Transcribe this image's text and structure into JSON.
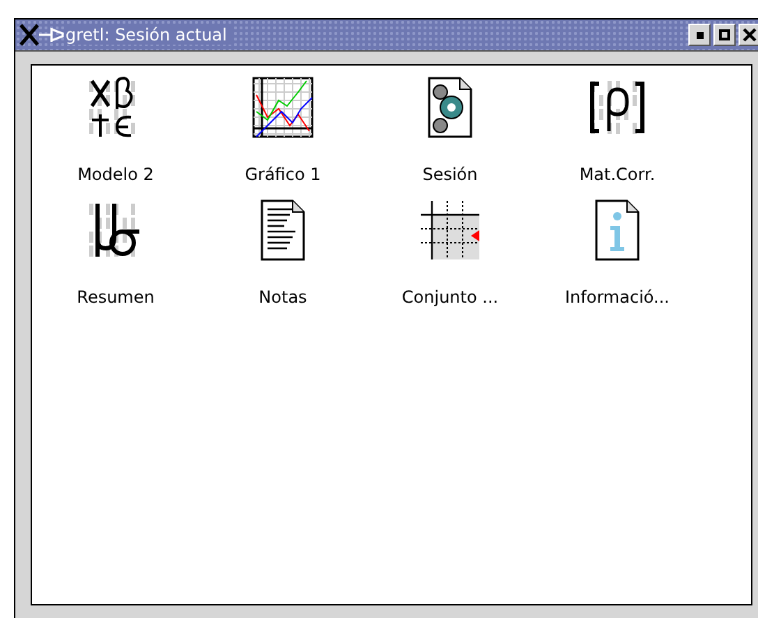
{
  "window": {
    "title": "gretl: Sesión actual"
  },
  "icons": [
    {
      "label": "Modelo 2",
      "kind": "model"
    },
    {
      "label": "Gráfico 1",
      "kind": "graph"
    },
    {
      "label": "Sesión",
      "kind": "session"
    },
    {
      "label": "Mat.Corr.",
      "kind": "matrix"
    },
    {
      "label": "Resumen",
      "kind": "summary"
    },
    {
      "label": "Notas",
      "kind": "notes"
    },
    {
      "label": "Conjunto ...",
      "kind": "dataset"
    },
    {
      "label": "Informació...",
      "kind": "info"
    }
  ]
}
